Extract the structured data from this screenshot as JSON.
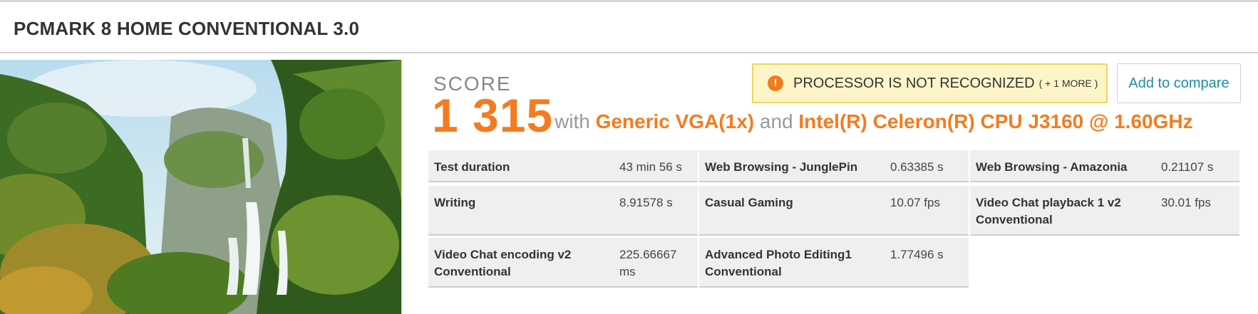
{
  "header": {
    "title": "PCMARK 8 HOME CONVENTIONAL 3.0"
  },
  "score": {
    "label": "SCORE",
    "value": "1 315",
    "with_text": "with",
    "gpu": "Generic VGA(1x)",
    "and_text": "and",
    "cpu": "Intel(R) Celeron(R) CPU J3160 @ 1.60GHz"
  },
  "warning": {
    "icon": "exclamation-icon",
    "text": "PROCESSOR IS NOT RECOGNIZED",
    "more": "( + 1 MORE )"
  },
  "compare_button": {
    "label": "Add to compare"
  },
  "details": [
    {
      "label": "Test duration",
      "value": "43 min 56 s"
    },
    {
      "label": "Web Browsing - JunglePin",
      "value": "0.63385 s"
    },
    {
      "label": "Web Browsing - Amazonia",
      "value": "0.21107 s"
    },
    {
      "label": "Writing",
      "value": "8.91578 s"
    },
    {
      "label": "Casual Gaming",
      "value": "10.07 fps"
    },
    {
      "label": "Video Chat playback 1 v2 Conventional",
      "value": "30.01 fps"
    },
    {
      "label": "Video Chat encoding v2 Conventional",
      "value": "225.66667 ms"
    },
    {
      "label": "Advanced Photo Editing1 Conventional",
      "value": "1.77496 s"
    }
  ],
  "colors": {
    "accent": "#f47b20",
    "link": "#1c8ea7",
    "warning_bg": "#fdf5c8"
  }
}
